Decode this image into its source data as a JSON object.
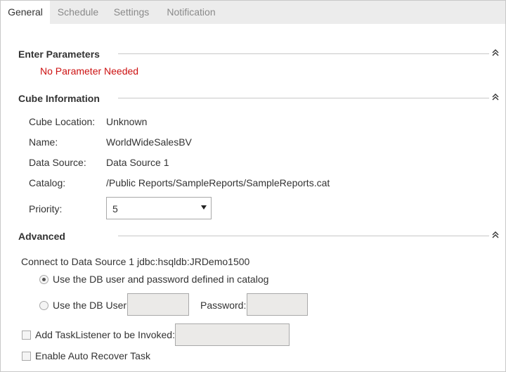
{
  "tabs": [
    {
      "label": "General",
      "active": true
    },
    {
      "label": "Schedule",
      "active": false
    },
    {
      "label": "Settings",
      "active": false
    },
    {
      "label": "Notification",
      "active": false
    }
  ],
  "enter_parameters": {
    "title": "Enter Parameters",
    "message": "No Parameter Needed"
  },
  "cube_information": {
    "title": "Cube Information",
    "rows": [
      {
        "label": "Cube Location:",
        "value": "Unknown"
      },
      {
        "label": "Name:",
        "value": "WorldWideSalesBV"
      },
      {
        "label": "Data Source:",
        "value": "Data Source 1"
      },
      {
        "label": "Catalog:",
        "value": "/Public Reports/SampleReports/SampleReports.cat"
      }
    ],
    "priority_label": "Priority:",
    "priority_value": "5"
  },
  "advanced": {
    "title": "Advanced",
    "connect_text": "Connect to Data Source 1 jdbc:hsqldb:JRDemo1500",
    "radio_catalog_label": "Use the DB user and password defined in catalog",
    "radio_catalog_checked": true,
    "radio_user_label": "Use the DB User:",
    "radio_user_checked": false,
    "db_user_value": "",
    "password_label": "Password:",
    "password_value": "",
    "task_listener_label": "Add TaskListener to be Invoked:",
    "task_listener_checked": false,
    "task_listener_value": "",
    "auto_recover_label": "Enable Auto Recover Task",
    "auto_recover_checked": false
  },
  "icons": {
    "collapse": "double-chevron-up-icon",
    "dropdown": "triangle-down-icon"
  },
  "colors": {
    "accent_red": "#cc1111",
    "tabbar_bg": "#ececec",
    "input_bg": "#ebeae8"
  }
}
